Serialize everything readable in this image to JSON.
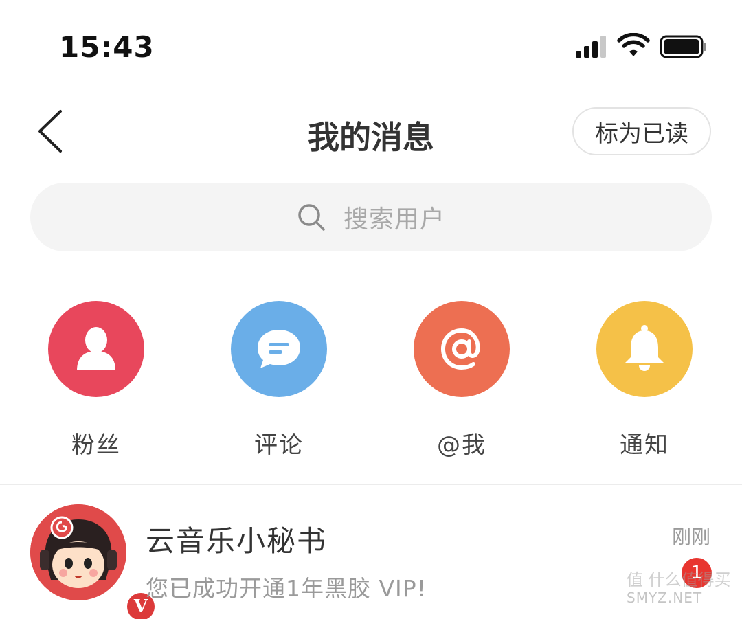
{
  "status_bar": {
    "time": "15:43",
    "icons": [
      "signal-icon",
      "wifi-icon",
      "battery-icon"
    ]
  },
  "nav": {
    "back_icon": "chevron-left-icon",
    "title": "我的消息",
    "mark_read_label": "标为已读"
  },
  "search": {
    "icon": "search-icon",
    "placeholder": "搜索用户"
  },
  "categories": [
    {
      "label": "粉丝",
      "icon": "person-icon",
      "color": "#e8475c"
    },
    {
      "label": "评论",
      "icon": "comment-icon",
      "color": "#6aaee8"
    },
    {
      "label": "@我",
      "icon": "at-icon",
      "color": "#ed6f52"
    },
    {
      "label": "通知",
      "icon": "bell-icon",
      "color": "#f5c148"
    }
  ],
  "messages": [
    {
      "name": "云音乐小秘书",
      "preview": "您已成功开通1年黑胶 VIP!",
      "time": "刚刚",
      "unread": "1",
      "badge": "V",
      "avatar_color": "#e04a4a"
    }
  ],
  "watermark": "SMYZ.NET",
  "watermark_text": "值 什么值得买"
}
